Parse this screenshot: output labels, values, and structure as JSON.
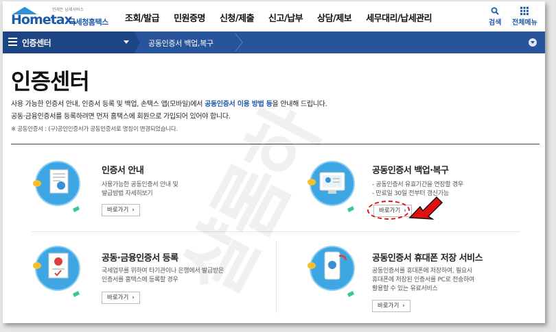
{
  "logo": {
    "tagline": "언제든 납세서비스",
    "brand": "Hometax.",
    "brand_kr": "국세청홈택스"
  },
  "nav": [
    "조회/발급",
    "민원증명",
    "신청/제출",
    "신고/납부",
    "상담/제보",
    "세무대리/납세관리"
  ],
  "utilities": {
    "search_label": "검색",
    "menu_label": "전체메뉴"
  },
  "bluebar": {
    "section": "인증센터",
    "breadcrumb": "공동인증서 백업,복구"
  },
  "intro": {
    "title": "인증센터",
    "line1_pre": "사용 가능한 인증서 안내, 인증서 등록 및 백업, 손택스 앱(모바일)에서 ",
    "line1_bold": "공동인증서 이용 방법 등",
    "line1_post": "을 안내해 드립니다.",
    "line2": "공동·금융인증서를 등록하려면 먼저 홈택스에 회원으로 가입되어 있어야 합니다.",
    "note": "※ 공동인증서 : (구)공인인증서가 공동인증서로 명칭이 변경되었습니다."
  },
  "cards": [
    {
      "title": "인증서 안내",
      "desc": [
        "사용가능한 공동인증서 안내 및",
        "발급방법 자세히보기"
      ],
      "button": "바로가기"
    },
    {
      "title": "공동인증서 백업·복구",
      "desc": [
        "- 공동인증서 유효기간을 연장할 경우",
        "- 만료일 30일 전부터 갱신가능"
      ],
      "button": "바로가기"
    },
    {
      "title": "공동·금융인증서 등록",
      "desc": [
        "국세업무를 위하여 타기관이나 은행에서 발급받은",
        "인증서를 홈택스에 등록할 경우"
      ],
      "button": "바로가기"
    },
    {
      "title": "공동인증서 휴대폰 저장 서비스",
      "desc": [
        "공동인증서를 휴대폰에 저장하여, 필요시",
        "휴대폰에 저장된 인증서를 PC로 전송하여",
        "활용할 수 있는 유료서비스"
      ],
      "button": "바로가기"
    }
  ],
  "watermark": "샬롬하",
  "colors": {
    "brand_blue": "#1f5aa8",
    "bar_blue": "#27549a",
    "highlight_red": "#e01010"
  }
}
